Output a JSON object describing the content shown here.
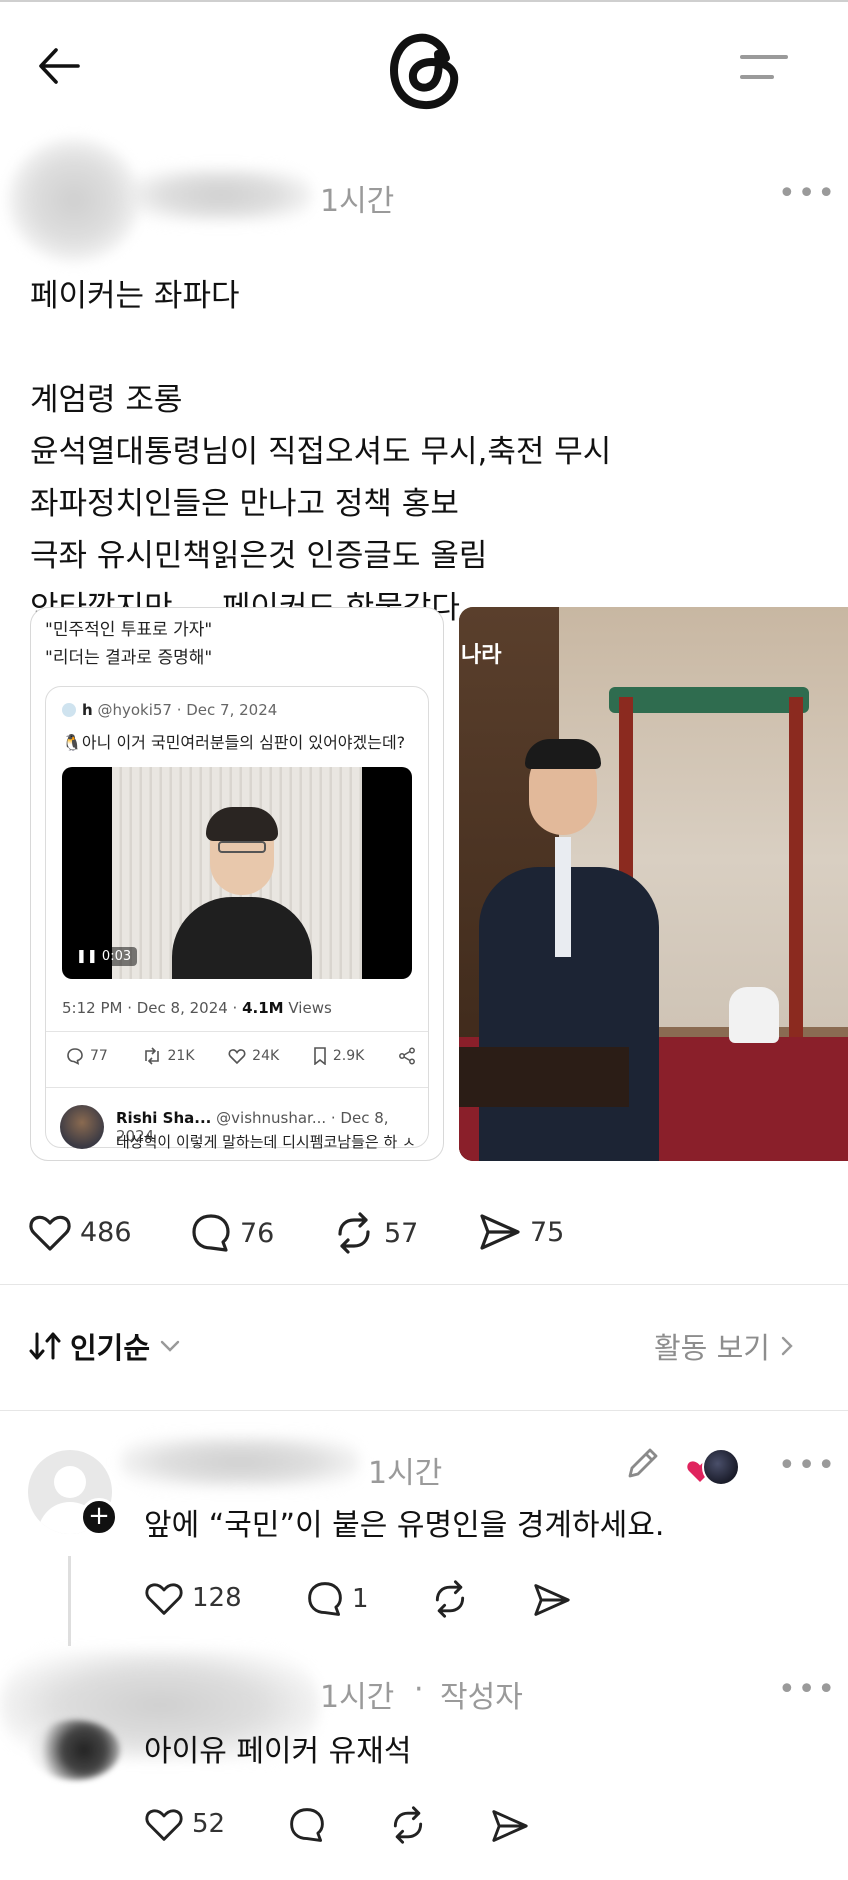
{
  "header": {
    "back_icon": "arrow-left-icon",
    "logo_icon": "threads-logo-icon",
    "menu_icon": "hamburger-menu-icon"
  },
  "post": {
    "time": "1시간",
    "more": "•••",
    "text": "페이커는 좌파다\n\n계엄령 조롱\n윤석열대통령님이 직접오셔도 무시,축전 무시\n좌파정치인들은 만나고 정책 홍보\n극좌 유시민책읽은것 인증글도 올림\n안타깝지만 ... 페이커도 한물갔다",
    "media_left": {
      "quote": "\"민주적인 투표로 가자\"\n\"리더는 결과로 증명해\"",
      "handle_name": "h",
      "handle_rest": " @hyoki57 · Dec 7, 2024",
      "tweet": "🐧아니 이거 국민여러분들의 심판이 있어야겠는데?",
      "video_time": "0:03",
      "meta_time": "5:12 PM · Dec 8, 2024 · ",
      "meta_views_num": "4.1M",
      "meta_views_label": " Views",
      "stats": [
        "77",
        "21K",
        "24K",
        "2.9K"
      ],
      "reply_name": "Rishi Sha...",
      "reply_rest": " @vishnushar... · Dec 8, 2024",
      "reply_text": "대상혁이 이렇게 말하는데 디시펨코남들은 하 ㅅ"
    },
    "media_right": {
      "sign_text": "나라"
    },
    "actions": {
      "likes": "486",
      "comments": "76",
      "reposts": "57",
      "shares": "75"
    }
  },
  "sort": {
    "label": "인기순",
    "activity": "활동 보기"
  },
  "comments": [
    {
      "time": "1시간",
      "text": "앞에 “국민”이 붙은 유명인을 경계하세요.",
      "likes": "128",
      "replies": "1",
      "more": "•••"
    },
    {
      "time": "1시간",
      "author_tag": "작성자",
      "text": "아이유 페이커 유재석",
      "likes": "52",
      "more": "•••"
    }
  ],
  "colors": {
    "text": "#101010",
    "muted": "#9a9a9a",
    "heart_red": "#e0245e"
  }
}
